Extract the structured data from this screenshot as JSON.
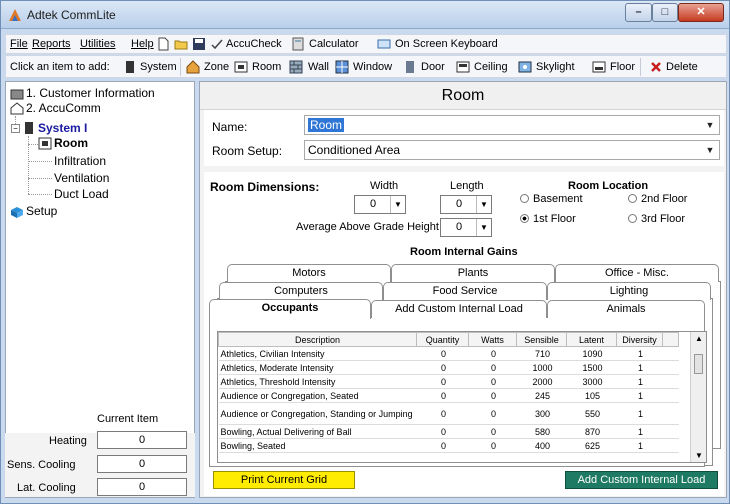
{
  "window": {
    "title": "Adtek CommLite"
  },
  "menu": {
    "file": "File",
    "reports": "Reports",
    "utilities": "Utilities",
    "help": "Help",
    "accucheck": "AccuCheck",
    "calculator": "Calculator",
    "keyboard": "On Screen Keyboard"
  },
  "toolbar": {
    "prompt": "Click an item to add:",
    "items": [
      "System",
      "Zone",
      "Room",
      "Wall",
      "Window",
      "Door",
      "Ceiling",
      "Skylight",
      "Floor",
      "Delete"
    ]
  },
  "tree": {
    "customer": "1. Customer Information",
    "accucomm": "2. AccuComm",
    "system": "System I",
    "room": "Room",
    "infiltration": "Infiltration",
    "ventilation": "Ventilation",
    "duct": "Duct Load",
    "setup": "Setup"
  },
  "current_item": {
    "title": "Current Item",
    "heating_label": "Heating",
    "heating": "0",
    "sens_label": "Sens. Cooling",
    "sens": "0",
    "lat_label": "Lat. Cooling",
    "lat": "0"
  },
  "room": {
    "header": "Room",
    "name_label": "Name:",
    "name_value": "Room",
    "setup_label": "Room Setup:",
    "setup_value": "Conditioned Area"
  },
  "dimensions": {
    "title": "Room Dimensions:",
    "width_label": "Width",
    "width": "0",
    "length_label": "Length",
    "length": "0",
    "agh_label": "Average Above Grade Height",
    "agh": "0",
    "location_title": "Room Location",
    "basement": "Basement",
    "floor2": "2nd Floor",
    "floor1": "1st Floor",
    "floor3": "3rd Floor"
  },
  "gains": {
    "title": "Room Internal Gains",
    "tabs_row1": [
      "Motors",
      "Plants",
      "Office - Misc."
    ],
    "tabs_row2": [
      "Computers",
      "Food Service",
      "Lighting"
    ],
    "tabs_row3": [
      "Occupants",
      "Add Custom Internal Load",
      "Animals"
    ],
    "columns": [
      "Description",
      "Quantity",
      "Watts",
      "Sensible",
      "Latent",
      "Diversity"
    ],
    "rows": [
      [
        "Athletics, Civilian Intensity",
        "0",
        "0",
        "710",
        "1090",
        "1"
      ],
      [
        "Athletics, Moderate Intensity",
        "0",
        "0",
        "1000",
        "1500",
        "1"
      ],
      [
        "Athletics, Threshold Intensity",
        "0",
        "0",
        "2000",
        "3000",
        "1"
      ],
      [
        "Audience or Congregation, Seated",
        "0",
        "0",
        "245",
        "105",
        "1"
      ],
      [
        "Audience or Congregation, Standing or Jumping",
        "0",
        "0",
        "300",
        "550",
        "1"
      ],
      [
        "Bowling, Actual Delivering of Ball",
        "0",
        "0",
        "580",
        "870",
        "1"
      ],
      [
        "Bowling, Seated",
        "0",
        "0",
        "400",
        "625",
        "1"
      ]
    ]
  },
  "buttons": {
    "print": "Print Current Grid",
    "add_custom": "Add Custom Internal Load"
  },
  "colors": {
    "print_bg": "#ffec00",
    "custom_bg": "#1f7a63",
    "selection": "#3076d6"
  }
}
